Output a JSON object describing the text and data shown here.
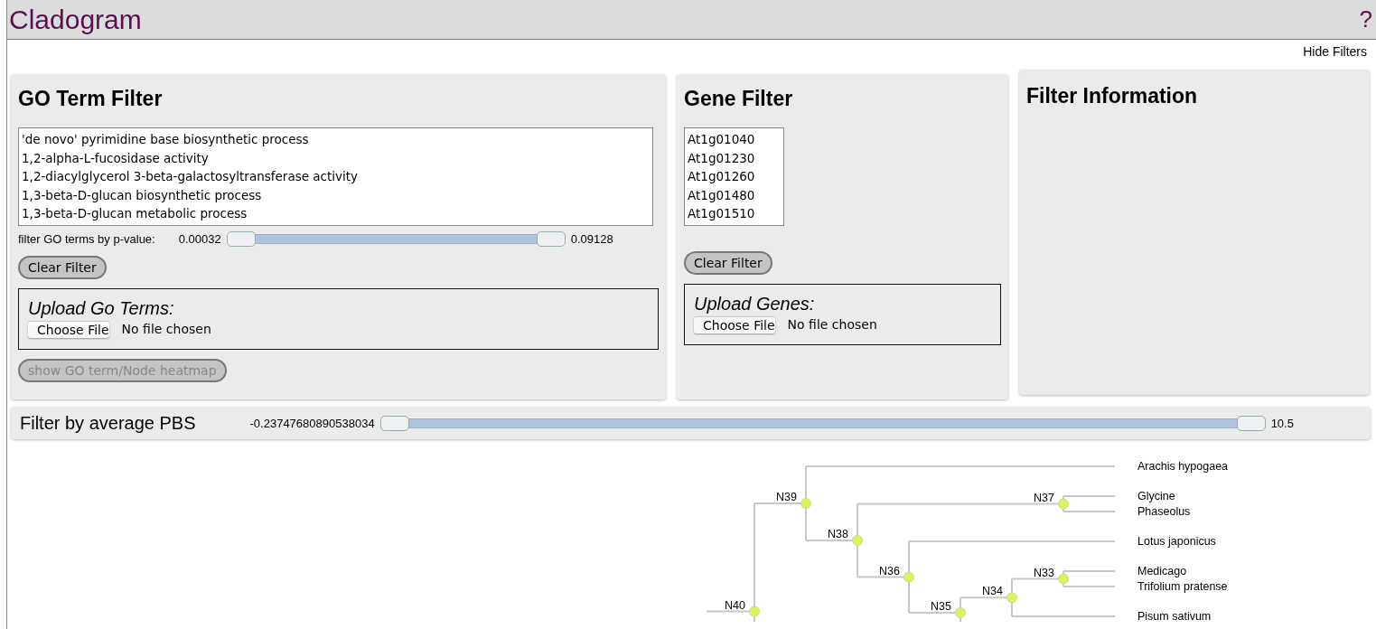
{
  "header": {
    "title": "Cladogram",
    "help": "?"
  },
  "hide_filters": "Hide Filters",
  "go_filter": {
    "title": "GO Term Filter",
    "terms": [
      "'de novo' pyrimidine base biosynthetic process",
      "1,2-alpha-L-fucosidase activity",
      "1,2-diacylglycerol 3-beta-galactosyltransferase activity",
      "1,3-beta-D-glucan biosynthetic process",
      "1,3-beta-D-glucan metabolic process"
    ],
    "pvalue": {
      "label": "filter GO terms by p-value:",
      "min": "0.00032",
      "max": "0.09128",
      "handles": [
        {
          "level": 0
        },
        {
          "level": 1
        }
      ]
    },
    "clear_button": "Clear Filter",
    "upload": {
      "label": "Upload Go Terms:",
      "button": "Choose File",
      "status": "No file chosen"
    },
    "heatmap_button": {
      "label": "show GO term/Node heatmap",
      "disabled": true
    }
  },
  "gene_filter": {
    "title": "Gene Filter",
    "genes": [
      "At1g01040",
      "At1g01230",
      "At1g01260",
      "At1g01480",
      "At1g01510"
    ],
    "clear_button": "Clear Filter",
    "upload": {
      "label": "Upload Genes:",
      "button": "Choose File",
      "status": "No file chosen"
    }
  },
  "filter_info": {
    "title": "Filter Information"
  },
  "pbs_filter": {
    "label": "Filter by average PBS",
    "min": "-0.23747680890538034",
    "max": "10.5",
    "handles": [
      {
        "level": 0
      },
      {
        "level": 1
      }
    ]
  },
  "cladogram": {
    "root": {
      "name": "N40",
      "continues_below": true,
      "children": [
        {
          "name": "N39",
          "children": [
            {
              "name": "Arachis hypogaea"
            },
            {
              "name": "N38",
              "children": [
                {
                  "name": "N37",
                  "children": [
                    {
                      "name": "Glycine"
                    },
                    {
                      "name": "Phaseolus"
                    }
                  ]
                },
                {
                  "name": "N36",
                  "children": [
                    {
                      "name": "Lotus japonicus"
                    },
                    {
                      "name": "N35",
                      "continues_below": true,
                      "children": [
                        {
                          "name": "N34",
                          "children": [
                            {
                              "name": "N33",
                              "children": [
                                {
                                  "name": "Medicago"
                                },
                                {
                                  "name": "Trifolium pratense"
                                }
                              ]
                            },
                            {
                              "name": "Pisum sativum"
                            }
                          ]
                        }
                      ]
                    }
                  ]
                }
              ]
            }
          ]
        }
      ]
    }
  }
}
